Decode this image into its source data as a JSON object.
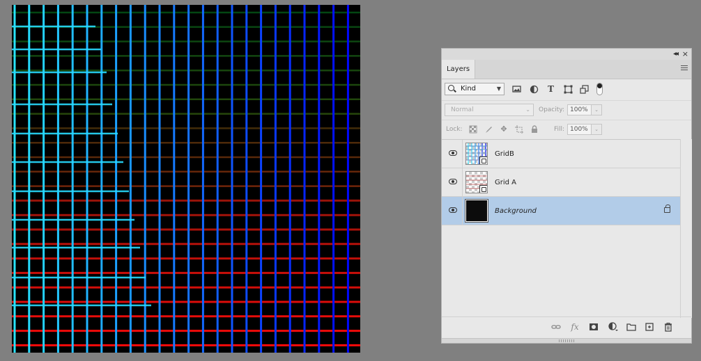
{
  "document": {
    "canvas_description_colors": {
      "background": "#000000",
      "gridA_top": "#00ffff",
      "gridA_bottom": "#ff0000",
      "gridB_left": "#0b6b2a",
      "gridB_right": "#0000ff"
    }
  },
  "panel": {
    "tab_label": "Layers",
    "collapse_glyph": "◂◂",
    "close_glyph": "×",
    "filter": {
      "kind_label": "Kind",
      "icons": [
        "image-filter-icon",
        "adjustment-filter-icon",
        "type-filter-icon",
        "shape-filter-icon",
        "smart-object-filter-icon"
      ]
    },
    "blend": {
      "mode": "Normal",
      "opacity_label": "Opacity:",
      "opacity_value": "100%"
    },
    "lock": {
      "label": "Lock:",
      "fill_label": "Fill:",
      "fill_value": "100%"
    },
    "layers": [
      {
        "name": "GridB",
        "visible": true,
        "selected": false,
        "italic": false
      },
      {
        "name": "Grid A",
        "visible": true,
        "selected": false,
        "italic": false
      },
      {
        "name": "Background",
        "visible": true,
        "selected": true,
        "italic": true,
        "locked": true
      }
    ],
    "bottom_icons": [
      "link-layers-icon",
      "fx-icon",
      "add-mask-icon",
      "adjustment-layer-icon",
      "new-group-icon",
      "new-layer-icon",
      "delete-icon"
    ],
    "fx_text": "fx"
  }
}
